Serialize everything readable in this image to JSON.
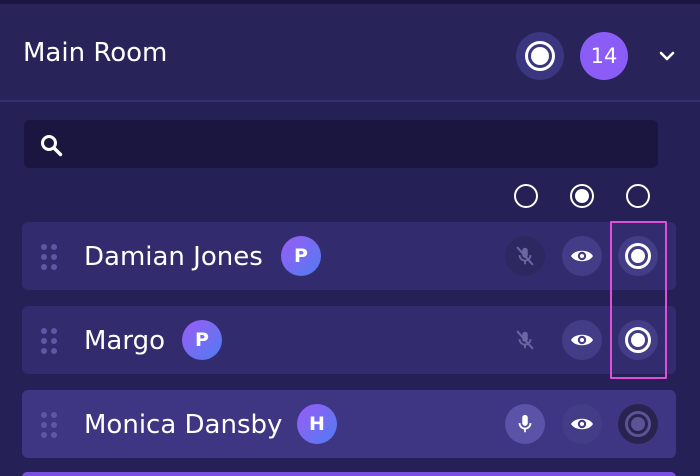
{
  "header": {
    "room_title": "Main Room",
    "participant_count": "14"
  },
  "search": {
    "placeholder": "",
    "value": ""
  },
  "columns": [
    "",
    "",
    ""
  ],
  "participants": [
    {
      "name": "Damian Jones",
      "role": "P",
      "mic": "muted",
      "selected_option": 2
    },
    {
      "name": "Margo",
      "role": "P",
      "mic": "muted",
      "selected_option": 2
    },
    {
      "name": "Monica Dansby",
      "role": "H",
      "mic": "on",
      "selected_option": null
    }
  ],
  "colors": {
    "background": "#252055",
    "accent_purple": "#8b5cf6",
    "row": "#322c6e",
    "row_hover": "#3e3682",
    "highlight": "#e04fd8"
  },
  "icons": [
    "record-icon",
    "chevron-down-icon",
    "search-icon",
    "drag-handle-icon",
    "mic-off-icon",
    "mic-icon",
    "eye-icon",
    "radio-selected-icon"
  ]
}
